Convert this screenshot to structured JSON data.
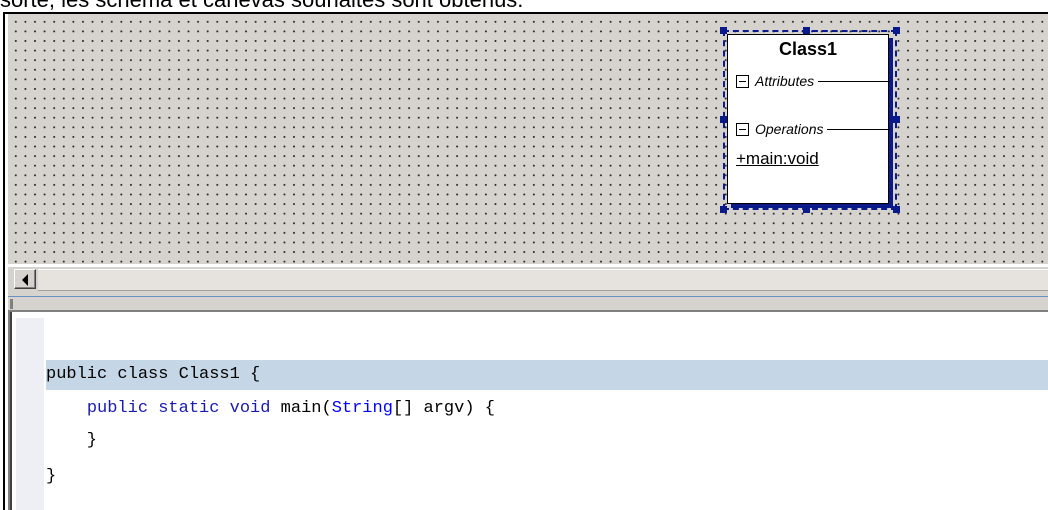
{
  "caption": "sorte, les schéma et canevas souhaités sont obtenus.",
  "diagram": {
    "class_name": "Class1",
    "attributes_label": "Attributes",
    "operations_label": "Operations",
    "operation": "+main:void"
  },
  "code": {
    "lines": [
      "public class Class1 {",
      "    public static void main(String[] argv) {",
      "    }",
      "}"
    ]
  },
  "colors": {
    "canvas": "#d6d3ce",
    "selection": "#0a1a8a",
    "current_line": "#c5d7e6",
    "keyword_type": "#0000ff"
  }
}
